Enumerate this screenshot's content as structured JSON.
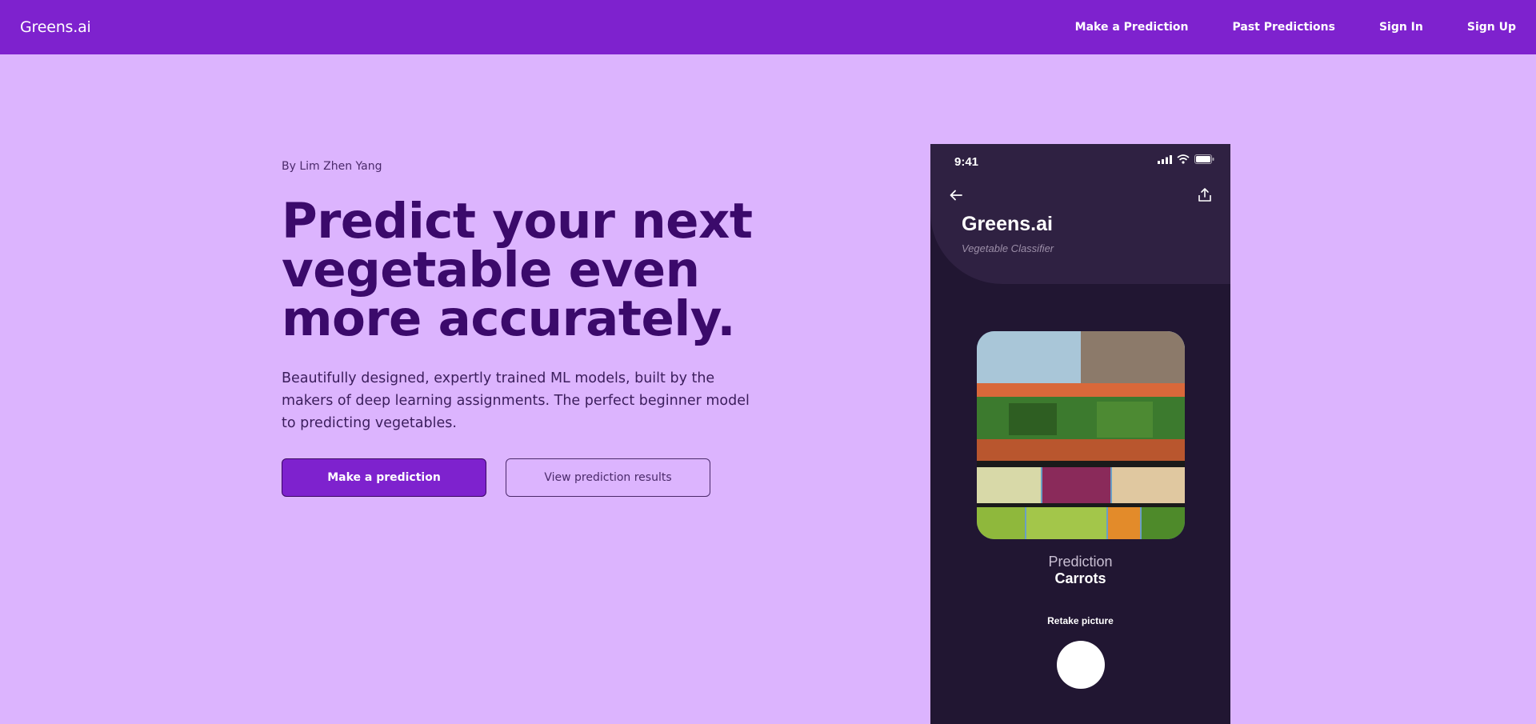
{
  "nav": {
    "brand": "Greens.ai",
    "links": [
      "Make a Prediction",
      "Past Predictions",
      "Sign In",
      "Sign Up"
    ]
  },
  "hero": {
    "byline": "By Lim Zhen Yang",
    "headline": "Predict your next vegetable even more accurately.",
    "subtext": "Beautifully designed, expertly trained ML models, built by the makers of deep learning assignments. The perfect beginner model to predicting vegetables.",
    "primary_button": "Make a prediction",
    "secondary_button": "View prediction results"
  },
  "phone": {
    "time": "9:41",
    "app_title": "Greens.ai",
    "app_subtitle": "Vegetable Classifier",
    "prediction_label": "Prediction",
    "prediction_value": "Carrots",
    "retake_label": "Retake picture",
    "icons": [
      "signal-icon",
      "wifi-icon",
      "battery-icon",
      "back-arrow-icon",
      "share-icon"
    ]
  },
  "colors": {
    "page_background": "#dcb4fe",
    "navbar": "#7e22ce",
    "headline": "#3b0a6b",
    "phone_background": "#211632",
    "phone_header": "#2f2142"
  }
}
